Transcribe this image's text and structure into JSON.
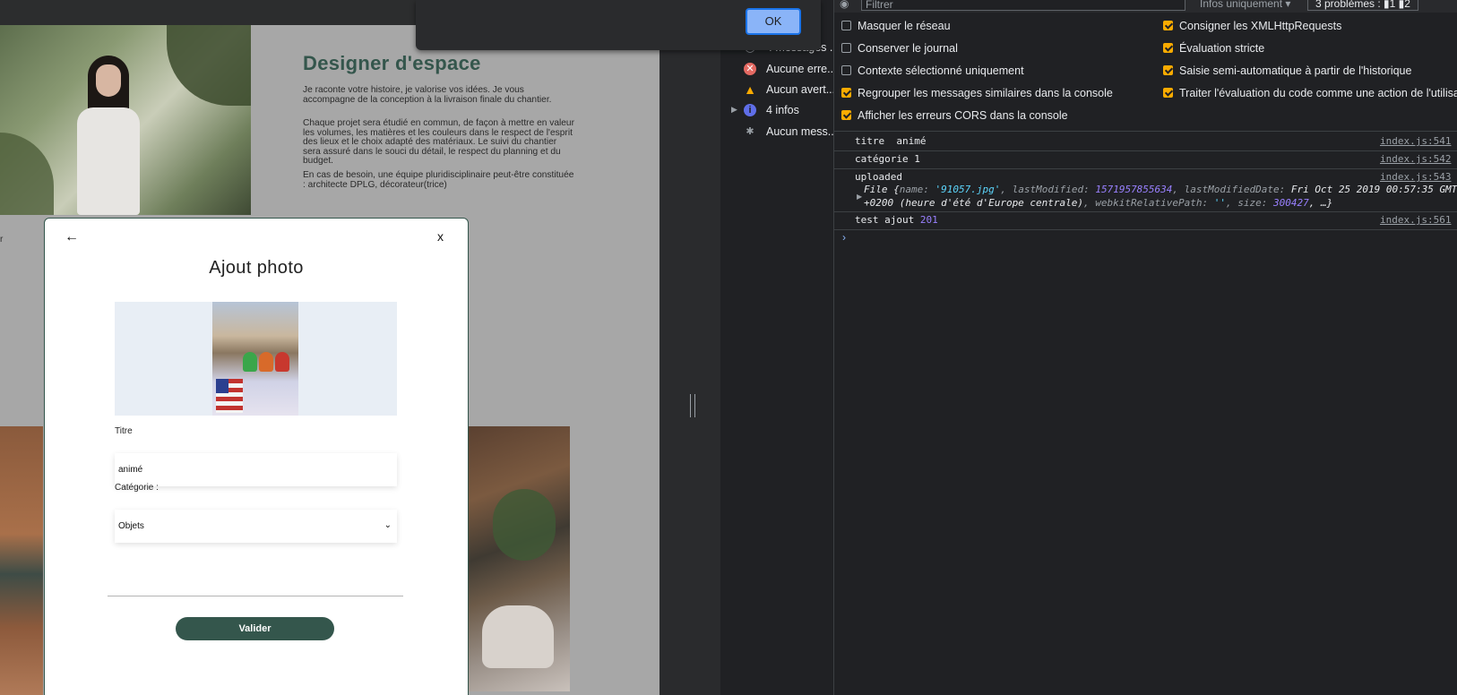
{
  "site": {
    "title": "Designer d'espace",
    "paragraphs": [
      "Je raconte votre histoire, je valorise vos idées. Je vous accompagne de la conception à la livraison finale du chantier.",
      "Chaque projet sera étudié en commun, de façon à mettre en valeur les volumes, les matières et les couleurs dans le respect de l'esprit des lieux et le choix adapté des matériaux. Le suivi du chantier sera assuré dans le souci du détail, le respect du planning et du budget.",
      "En cas de besoin, une équipe pluridisciplinaire peut-être constituée : architecte DPLG, décorateur(trice)"
    ],
    "cut_letter": "r"
  },
  "modal": {
    "back_icon": "←",
    "close_label": "x",
    "title": "Ajout photo",
    "titre_label": "Titre",
    "titre_value": "animé",
    "categorie_label": "Catégorie :",
    "categorie_value": "Objets",
    "validate_label": "Valider",
    "accent_color": "#34564c"
  },
  "alert": {
    "ok_label": "OK"
  },
  "devtools": {
    "filter_placeholder": "Filtrer",
    "levels_label": "Infos uniquement ▾",
    "problems_label": "3 problèmes : ▮1 ▮2",
    "sidebar": [
      {
        "icon": "messages-icon",
        "label": "4 messages ..."
      },
      {
        "icon": "error-icon",
        "label": "Aucune erre..."
      },
      {
        "icon": "warning-icon",
        "label": "Aucun avert..."
      },
      {
        "icon": "info-icon",
        "label": "4 infos"
      },
      {
        "icon": "verbose-icon",
        "label": "Aucun mess..."
      }
    ],
    "settings_left": [
      {
        "label": "Masquer le réseau",
        "checked": false
      },
      {
        "label": "Conserver le journal",
        "checked": false
      },
      {
        "label": "Contexte sélectionné uniquement",
        "checked": false
      },
      {
        "label": "Regrouper les messages similaires dans la console",
        "checked": true
      },
      {
        "label": "Afficher les erreurs CORS dans la console",
        "checked": true
      }
    ],
    "settings_right": [
      {
        "label": "Consigner les XMLHttpRequests",
        "checked": true
      },
      {
        "label": "Évaluation stricte",
        "checked": true
      },
      {
        "label": "Saisie semi-automatique à partir de l'historique",
        "checked": true
      },
      {
        "label": "Traiter l'évaluation du code comme une action de l'utilisateur",
        "checked": true
      }
    ],
    "logs": [
      {
        "msg": "titre  animé",
        "src": "index.js:541"
      },
      {
        "msg": "catégorie 1",
        "src": "index.js:542"
      },
      {
        "msg": "uploaded",
        "src": "index.js:543"
      },
      {
        "msg": "test ajout ",
        "num": "201",
        "src": "index.js:561"
      }
    ],
    "file_obj": {
      "prefix": "File {",
      "name_key": "name: ",
      "name_val": "'91057.jpg'",
      "lm_key": ", lastModified: ",
      "lm_val": "1571957855634",
      "lmd_key": ", lastModifiedDate: ",
      "lmd_val": "Fri Oct 25 2019 00:57:35 GMT",
      "line2_a": "+0200 (heure d'été d'Europe centrale)",
      "wrp_key": ", webkitRelativePath: ",
      "wrp_val": "''",
      "size_key": ", size: ",
      "size_val": "300427",
      "suffix": ", …}"
    },
    "prompt": "›"
  }
}
